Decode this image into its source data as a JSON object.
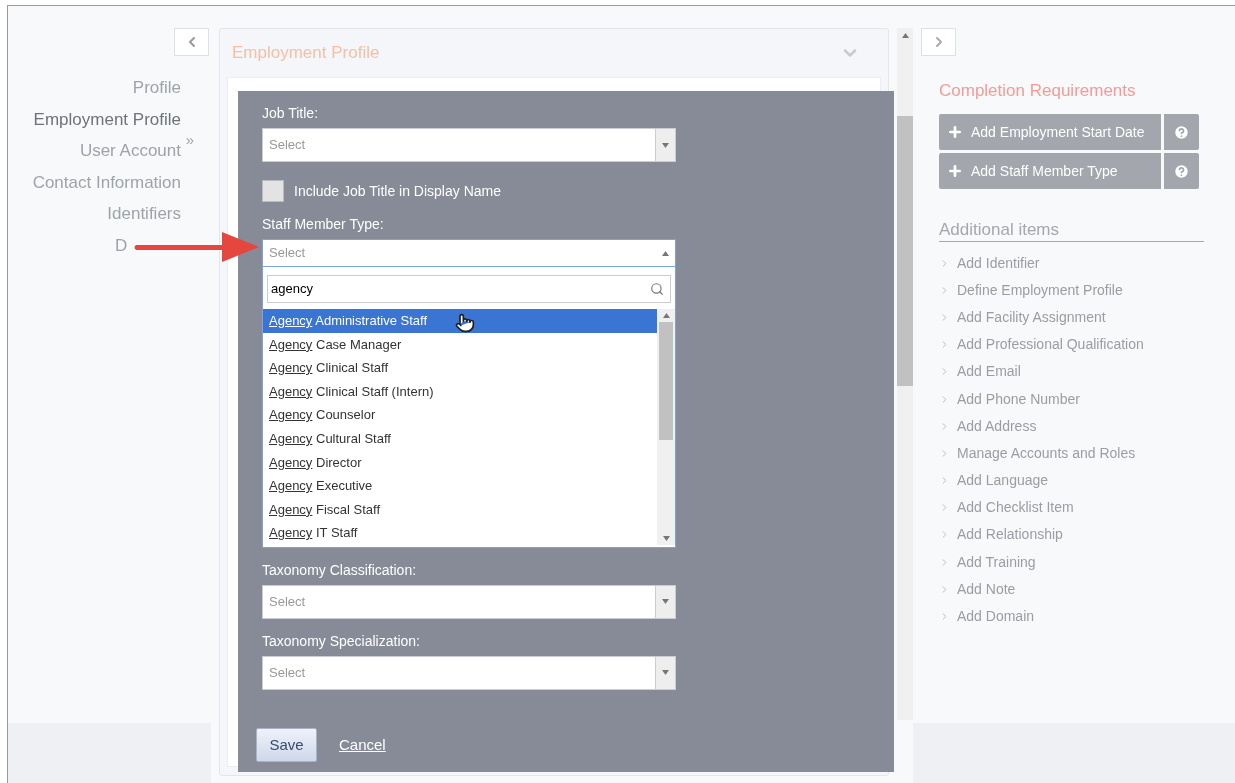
{
  "sidebar": {
    "items": [
      {
        "label": "Profile",
        "selected": false
      },
      {
        "label": "Employment Profile",
        "selected": true
      },
      {
        "label": "User Account",
        "selected": false,
        "marker": "»"
      },
      {
        "label": "Contact Information",
        "selected": false
      },
      {
        "label": "Identifiers",
        "selected": false
      },
      {
        "label": "D",
        "selected": false
      }
    ]
  },
  "panel": {
    "title": "Employment Profile"
  },
  "form": {
    "fields": [
      {
        "kind": "select",
        "label": "Job Title:",
        "placeholder": "Select"
      },
      {
        "kind": "checkbox",
        "label": "Include Job Title in Display Name",
        "checked": false
      },
      {
        "kind": "combo",
        "label": "Staff Member Type:",
        "placeholder": "Select",
        "expanded": true,
        "search": "agency",
        "options": [
          {
            "match": "Agency",
            "rest": " Administrative Staff",
            "selected": true
          },
          {
            "match": "Agency",
            "rest": " Case Manager",
            "selected": false
          },
          {
            "match": "Agency",
            "rest": " Clinical Staff",
            "selected": false
          },
          {
            "match": "Agency",
            "rest": " Clinical Staff (Intern)",
            "selected": false
          },
          {
            "match": "Agency",
            "rest": " Counselor",
            "selected": false
          },
          {
            "match": "Agency",
            "rest": " Cultural Staff",
            "selected": false
          },
          {
            "match": "Agency",
            "rest": " Director",
            "selected": false
          },
          {
            "match": "Agency",
            "rest": " Executive",
            "selected": false
          },
          {
            "match": "Agency",
            "rest": " Fiscal Staff",
            "selected": false
          },
          {
            "match": "Agency",
            "rest": " IT Staff",
            "selected": false
          }
        ]
      },
      {
        "kind": "select",
        "label": "Taxonomy Classification:",
        "placeholder": "Select"
      },
      {
        "kind": "select",
        "label": "Taxonomy Specialization:",
        "placeholder": "Select"
      }
    ],
    "save": "Save",
    "cancel": "Cancel"
  },
  "completion": {
    "title": "Completion Requirements",
    "items": [
      "Add Employment Start Date",
      "Add Staff Member Type"
    ]
  },
  "additional": {
    "title": "Additional items",
    "items": [
      "Add Identifier",
      "Define Employment Profile",
      "Add Facility Assignment",
      "Add Professional Qualification",
      "Add Email",
      "Add Phone Number",
      "Add Address",
      "Manage Accounts and Roles",
      "Add Language",
      "Add Checklist Item",
      "Add Relationship",
      "Add Training",
      "Add Note",
      "Add Domain"
    ]
  }
}
